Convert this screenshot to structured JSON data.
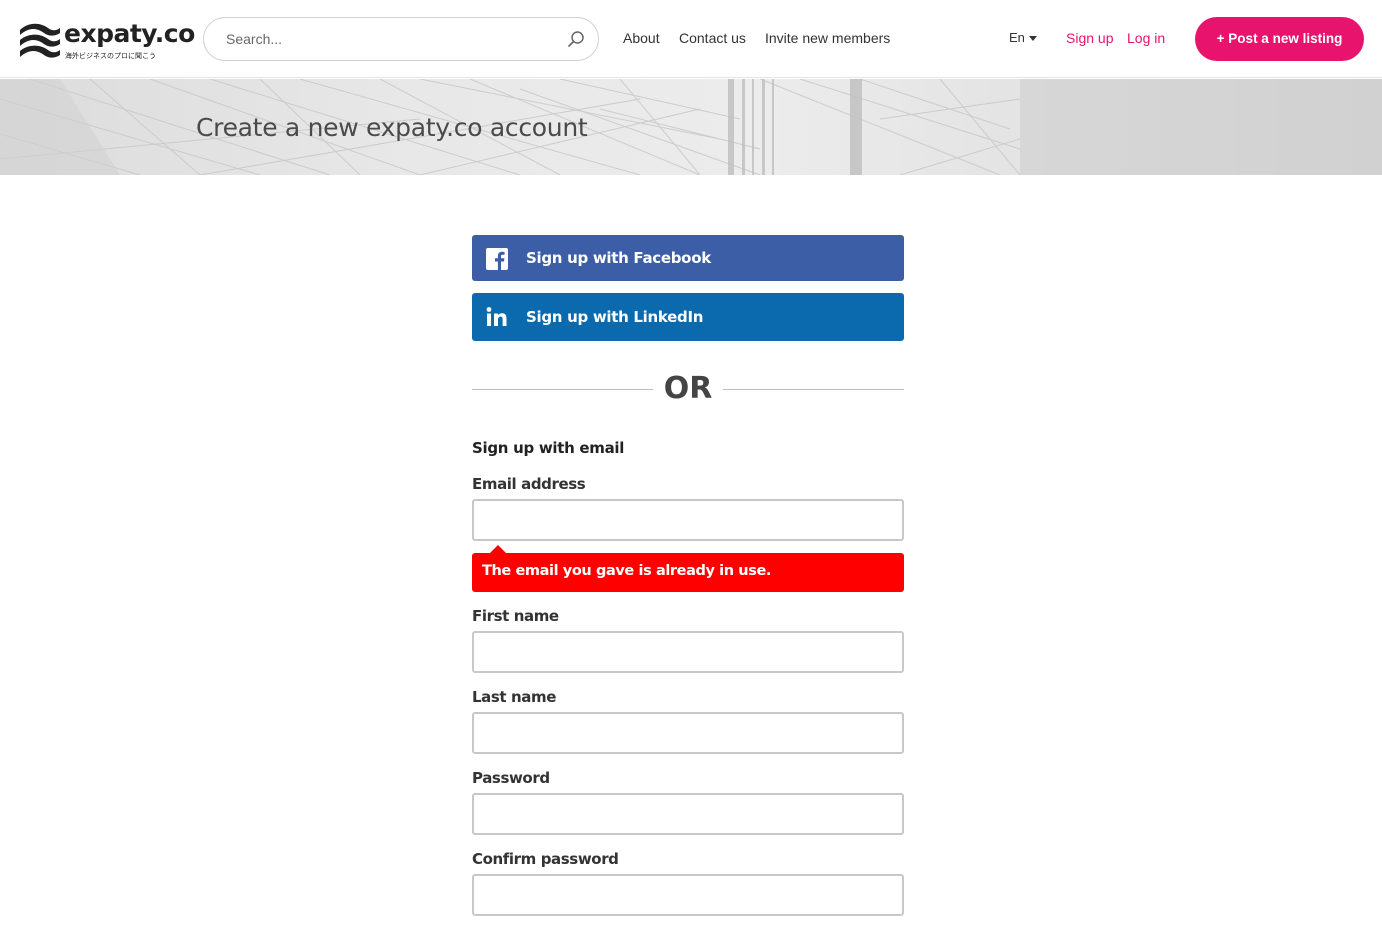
{
  "header": {
    "logo": {
      "text": "expaty.co",
      "tagline": "海外ビジネスのプロに聞こう"
    },
    "search": {
      "placeholder": "Search...",
      "icon": "search-icon"
    },
    "nav": {
      "about": "About",
      "contact": "Contact us",
      "invite": "Invite new members"
    },
    "language": {
      "selected": "En"
    },
    "auth": {
      "signup": "Sign up",
      "login": "Log in"
    },
    "post_button": "+ Post a new listing"
  },
  "hero": {
    "title": "Create a new expaty.co account"
  },
  "social": {
    "facebook": {
      "label": "Sign up with Facebook",
      "icon": "facebook-icon"
    },
    "linkedin": {
      "label": "Sign up with LinkedIn",
      "icon": "linkedin-icon"
    }
  },
  "divider": {
    "text": "OR"
  },
  "form": {
    "heading": "Sign up with email",
    "email": {
      "label": "Email address",
      "value": ""
    },
    "email_error": "The email you gave is already in use.",
    "first_name": {
      "label": "First name",
      "value": ""
    },
    "last_name": {
      "label": "Last name",
      "value": ""
    },
    "password": {
      "label": "Password",
      "value": ""
    },
    "confirm_password": {
      "label": "Confirm password",
      "value": ""
    }
  },
  "colors": {
    "brand_pink": "#e8136c",
    "facebook_blue": "#3b5ea7",
    "linkedin_blue": "#0a6aad",
    "error_red": "#ff0000"
  }
}
